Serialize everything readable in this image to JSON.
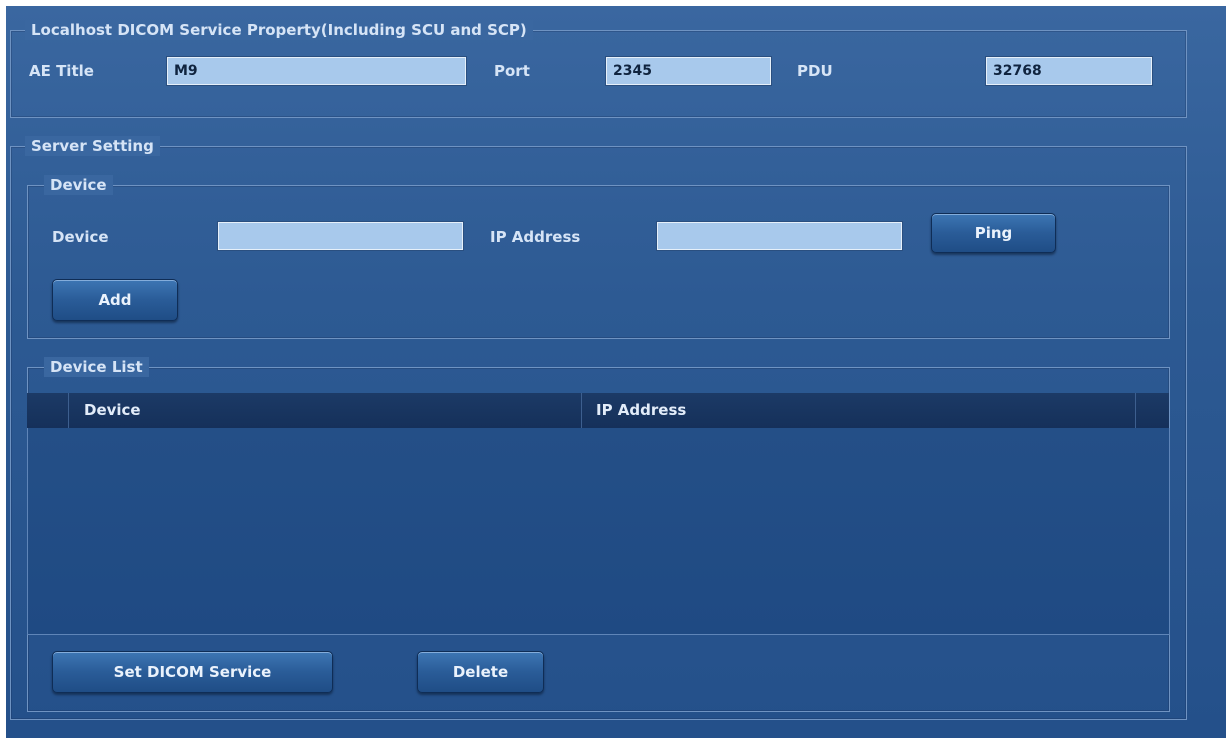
{
  "localhost": {
    "title": "Localhost DICOM Service Property(Including SCU and SCP)",
    "ae_title_label": "AE Title",
    "ae_title_value": "M9",
    "port_label": "Port",
    "port_value": "2345",
    "pdu_label": "PDU",
    "pdu_value": "32768"
  },
  "server": {
    "title": "Server Setting",
    "device_group": {
      "title": "Device",
      "device_label": "Device",
      "device_value": "",
      "ip_label": "IP Address",
      "ip_value": "",
      "ping_label": "Ping",
      "add_label": "Add"
    },
    "device_list": {
      "title": "Device List",
      "columns": [
        "Device",
        "IP Address"
      ],
      "rows": []
    },
    "set_dicom_label": "Set DICOM Service",
    "delete_label": "Delete"
  }
}
